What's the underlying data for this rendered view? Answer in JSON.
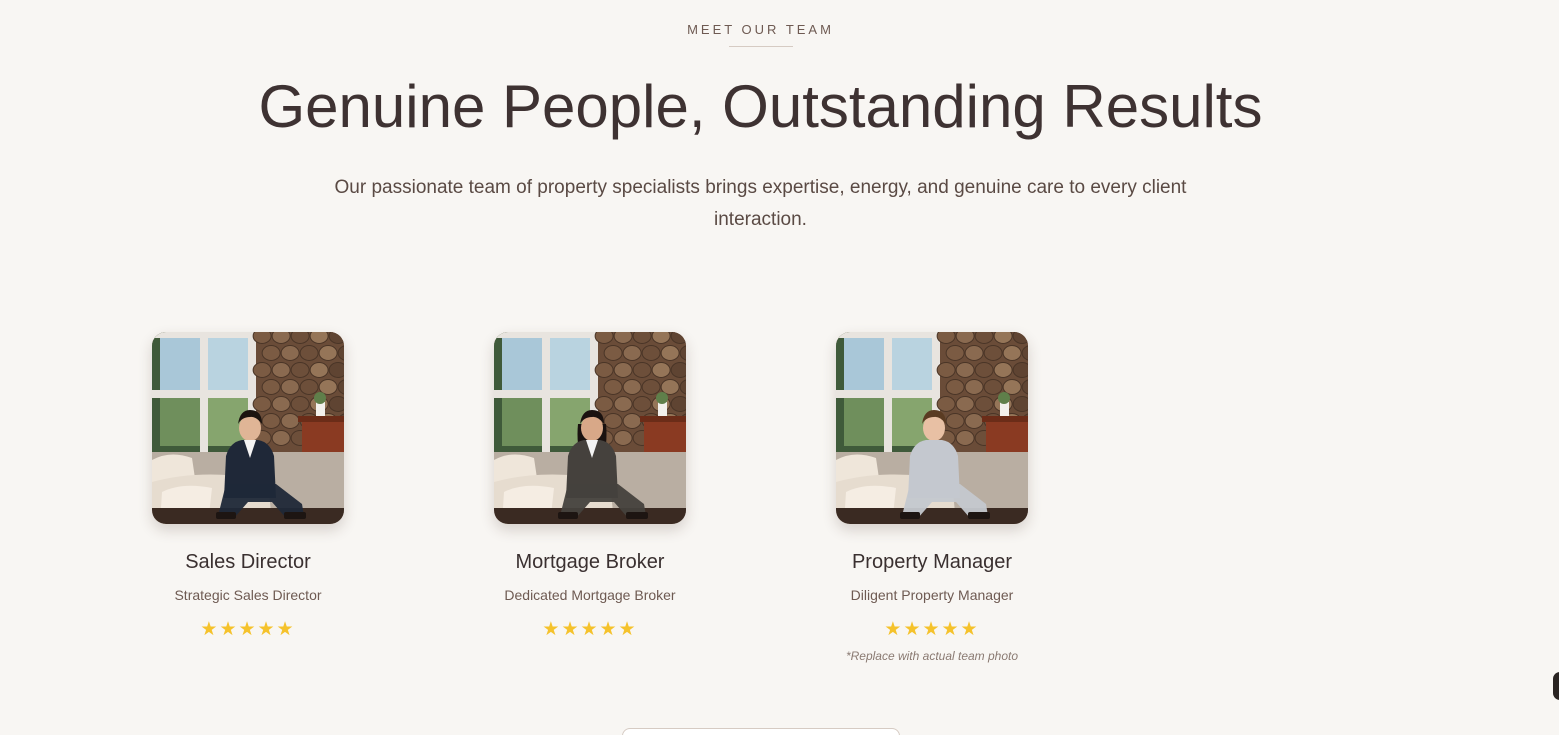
{
  "section": {
    "eyebrow": "MEET OUR TEAM",
    "headline": "Genuine People, Outstanding Results",
    "subtitle": "Our passionate team of property specialists brings expertise, energy, and genuine care to every client interaction."
  },
  "colors": {
    "background": "#f8f6f3",
    "heading": "#3e3232",
    "muted": "#6e5a52",
    "star": "#f5c22b"
  },
  "team": [
    {
      "name": "Sales Director",
      "role": "Strategic Sales Director",
      "stars": "★★★★★",
      "rating": 5,
      "suit": "#1f2838",
      "shirt": "#f4f4f4",
      "hair": "#1c1410",
      "skin": "#e0b596",
      "hair_style": "short",
      "photo_icon": "team-photo-man-navy-suit"
    },
    {
      "name": "Mortgage Broker",
      "role": "Dedicated Mortgage Broker",
      "stars": "★★★★★",
      "rating": 5,
      "suit": "#45413d",
      "shirt": "#f4f4f4",
      "hair": "#1a1210",
      "skin": "#d8a888",
      "hair_style": "long",
      "photo_icon": "team-photo-woman-grey-suit"
    },
    {
      "name": "Property Manager",
      "role": "Diligent Property Manager",
      "stars": "★★★★★",
      "rating": 5,
      "suit": "#c4c8cf",
      "shirt": "#c4c8cf",
      "hair": "#5a3b22",
      "skin": "#e8c0a4",
      "hair_style": "short",
      "photo_icon": "team-photo-man-grey-shirt",
      "note": "*Replace with actual team photo"
    }
  ]
}
